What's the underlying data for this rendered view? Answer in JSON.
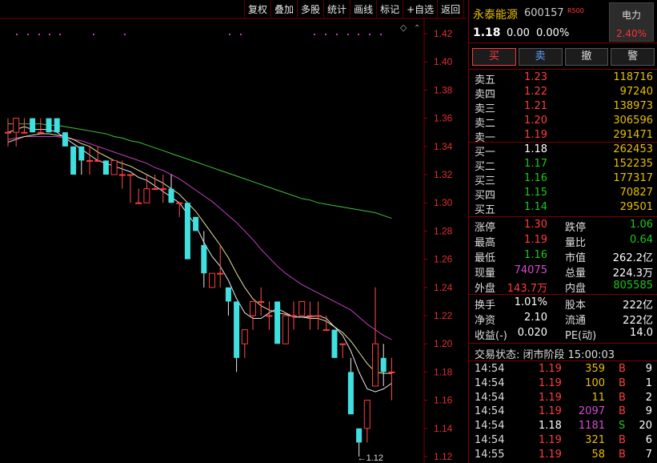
{
  "toolbar": [
    "复权",
    "叠加",
    "多股",
    "统计",
    "画线",
    "标记",
    "+自选",
    "返回"
  ],
  "chart_data": {
    "type": "candlestick",
    "yticks": [
      1.12,
      1.14,
      1.16,
      1.18,
      1.2,
      1.22,
      1.24,
      1.26,
      1.28,
      1.3,
      1.32,
      1.34,
      1.36,
      1.38,
      1.4,
      1.42
    ],
    "candles": [
      {
        "o": 1.35,
        "h": 1.36,
        "l": 1.34,
        "c": 1.35
      },
      {
        "o": 1.35,
        "h": 1.36,
        "l": 1.34,
        "c": 1.36
      },
      {
        "o": 1.35,
        "h": 1.36,
        "l": 1.35,
        "c": 1.35
      },
      {
        "o": 1.36,
        "h": 1.36,
        "l": 1.35,
        "c": 1.35
      },
      {
        "o": 1.35,
        "h": 1.36,
        "l": 1.35,
        "c": 1.35
      },
      {
        "o": 1.36,
        "h": 1.36,
        "l": 1.35,
        "c": 1.35
      },
      {
        "o": 1.36,
        "h": 1.36,
        "l": 1.35,
        "c": 1.35
      },
      {
        "o": 1.35,
        "h": 1.35,
        "l": 1.34,
        "c": 1.34
      },
      {
        "o": 1.34,
        "h": 1.34,
        "l": 1.32,
        "c": 1.32
      },
      {
        "o": 1.34,
        "h": 1.34,
        "l": 1.32,
        "c": 1.33
      },
      {
        "o": 1.33,
        "h": 1.34,
        "l": 1.32,
        "c": 1.33
      },
      {
        "o": 1.33,
        "h": 1.34,
        "l": 1.33,
        "c": 1.33
      },
      {
        "o": 1.33,
        "h": 1.33,
        "l": 1.32,
        "c": 1.32
      },
      {
        "o": 1.32,
        "h": 1.33,
        "l": 1.32,
        "c": 1.33
      },
      {
        "o": 1.32,
        "h": 1.33,
        "l": 1.31,
        "c": 1.32
      },
      {
        "o": 1.32,
        "h": 1.32,
        "l": 1.3,
        "c": 1.32
      },
      {
        "o": 1.3,
        "h": 1.31,
        "l": 1.3,
        "c": 1.3
      },
      {
        "o": 1.3,
        "h": 1.32,
        "l": 1.3,
        "c": 1.31
      },
      {
        "o": 1.31,
        "h": 1.32,
        "l": 1.31,
        "c": 1.31
      },
      {
        "o": 1.31,
        "h": 1.32,
        "l": 1.3,
        "c": 1.31
      },
      {
        "o": 1.31,
        "h": 1.32,
        "l": 1.3,
        "c": 1.3
      },
      {
        "o": 1.3,
        "h": 1.3,
        "l": 1.29,
        "c": 1.3
      },
      {
        "o": 1.3,
        "h": 1.3,
        "l": 1.26,
        "c": 1.26
      },
      {
        "o": 1.29,
        "h": 1.29,
        "l": 1.28,
        "c": 1.28
      },
      {
        "o": 1.27,
        "h": 1.28,
        "l": 1.24,
        "c": 1.25
      },
      {
        "o": 1.24,
        "h": 1.25,
        "l": 1.24,
        "c": 1.25
      },
      {
        "o": 1.25,
        "h": 1.27,
        "l": 1.24,
        "c": 1.25
      },
      {
        "o": 1.24,
        "h": 1.24,
        "l": 1.22,
        "c": 1.23
      },
      {
        "o": 1.23,
        "h": 1.23,
        "l": 1.18,
        "c": 1.19
      },
      {
        "o": 1.2,
        "h": 1.21,
        "l": 1.19,
        "c": 1.21
      },
      {
        "o": 1.22,
        "h": 1.23,
        "l": 1.21,
        "c": 1.23
      },
      {
        "o": 1.23,
        "h": 1.24,
        "l": 1.22,
        "c": 1.23
      },
      {
        "o": 1.22,
        "h": 1.23,
        "l": 1.21,
        "c": 1.22
      },
      {
        "o": 1.23,
        "h": 1.23,
        "l": 1.2,
        "c": 1.2
      },
      {
        "o": 1.2,
        "h": 1.22,
        "l": 1.2,
        "c": 1.22
      },
      {
        "o": 1.22,
        "h": 1.23,
        "l": 1.21,
        "c": 1.22
      },
      {
        "o": 1.22,
        "h": 1.23,
        "l": 1.22,
        "c": 1.23
      },
      {
        "o": 1.22,
        "h": 1.23,
        "l": 1.21,
        "c": 1.22
      },
      {
        "o": 1.22,
        "h": 1.23,
        "l": 1.21,
        "c": 1.22
      },
      {
        "o": 1.21,
        "h": 1.22,
        "l": 1.21,
        "c": 1.21
      },
      {
        "o": 1.21,
        "h": 1.21,
        "l": 1.19,
        "c": 1.19
      },
      {
        "o": 1.2,
        "h": 1.2,
        "l": 1.19,
        "c": 1.2
      },
      {
        "o": 1.18,
        "h": 1.19,
        "l": 1.15,
        "c": 1.15
      },
      {
        "o": 1.14,
        "h": 1.14,
        "l": 1.12,
        "c": 1.13
      },
      {
        "o": 1.14,
        "h": 1.16,
        "l": 1.13,
        "c": 1.16
      },
      {
        "o": 1.17,
        "h": 1.24,
        "l": 1.17,
        "c": 1.2
      },
      {
        "o": 1.19,
        "h": 1.2,
        "l": 1.17,
        "c": 1.18
      },
      {
        "o": 1.18,
        "h": 1.19,
        "l": 1.16,
        "c": 1.18
      }
    ],
    "ma_white": [
      1.35,
      1.352,
      1.354,
      1.352,
      1.352,
      1.352,
      1.35,
      1.346,
      1.342,
      1.338,
      1.334,
      1.33,
      1.328,
      1.326,
      1.324,
      1.322,
      1.318,
      1.316,
      1.312,
      1.308,
      1.304,
      1.3,
      1.292,
      1.284,
      1.272,
      1.262,
      1.255,
      1.245,
      1.232,
      1.222,
      1.218,
      1.218,
      1.222,
      1.225,
      1.222,
      1.219,
      1.219,
      1.219,
      1.22,
      1.218,
      1.212,
      1.206,
      1.195,
      1.18,
      1.168,
      1.166,
      1.168,
      1.172
    ],
    "ma_yellow": [
      1.343,
      1.345,
      1.347,
      1.348,
      1.349,
      1.349,
      1.348,
      1.347,
      1.345,
      1.342,
      1.34,
      1.336,
      1.333,
      1.33,
      1.328,
      1.326,
      1.323,
      1.32,
      1.317,
      1.314,
      1.31,
      1.306,
      1.3,
      1.294,
      1.286,
      1.278,
      1.27,
      1.261,
      1.25,
      1.24,
      1.232,
      1.227,
      1.224,
      1.222,
      1.221,
      1.219,
      1.219,
      1.218,
      1.218,
      1.216,
      1.212,
      1.208,
      1.202,
      1.194,
      1.186,
      1.18,
      1.179,
      1.179
    ],
    "ma_magenta": [
      1.345,
      1.346,
      1.347,
      1.347,
      1.347,
      1.347,
      1.347,
      1.346,
      1.345,
      1.344,
      1.342,
      1.34,
      1.338,
      1.336,
      1.334,
      1.332,
      1.33,
      1.328,
      1.325,
      1.323,
      1.32,
      1.317,
      1.313,
      1.309,
      1.305,
      1.301,
      1.296,
      1.291,
      1.286,
      1.28,
      1.274,
      1.267,
      1.261,
      1.255,
      1.25,
      1.246,
      1.242,
      1.239,
      1.236,
      1.233,
      1.23,
      1.227,
      1.224,
      1.219,
      1.214,
      1.21,
      1.206,
      1.203
    ],
    "ma_green": [
      1.356,
      1.356,
      1.356,
      1.356,
      1.356,
      1.355,
      1.355,
      1.354,
      1.353,
      1.352,
      1.351,
      1.35,
      1.349,
      1.347,
      1.346,
      1.344,
      1.343,
      1.341,
      1.339,
      1.337,
      1.335,
      1.333,
      1.331,
      1.329,
      1.327,
      1.325,
      1.323,
      1.321,
      1.319,
      1.317,
      1.315,
      1.313,
      1.311,
      1.309,
      1.307,
      1.305,
      1.303,
      1.302,
      1.3,
      1.299,
      1.298,
      1.297,
      1.296,
      1.295,
      1.294,
      1.293,
      1.291,
      1.289
    ],
    "low_label": "1.12"
  },
  "stock": {
    "name": "永泰能源",
    "code": "600157",
    "r_tag": "R500",
    "price": "1.18",
    "change": "0.00",
    "change_pct": "0.00%"
  },
  "sector": {
    "name": "电力",
    "change": "2.40%"
  },
  "buttons": {
    "buy": "买",
    "sell": "卖",
    "cancel": "撤",
    "warn": "警"
  },
  "asks": [
    {
      "label": "卖五",
      "price": "1.23",
      "vol": "118716"
    },
    {
      "label": "卖四",
      "price": "1.22",
      "vol": "97240"
    },
    {
      "label": "卖三",
      "price": "1.21",
      "vol": "138973"
    },
    {
      "label": "卖二",
      "price": "1.20",
      "vol": "306596"
    },
    {
      "label": "卖一",
      "price": "1.19",
      "vol": "291471"
    }
  ],
  "bids": [
    {
      "label": "买一",
      "price": "1.18",
      "vol": "262453"
    },
    {
      "label": "买二",
      "price": "1.17",
      "vol": "152235"
    },
    {
      "label": "买三",
      "price": "1.16",
      "vol": "177317"
    },
    {
      "label": "买四",
      "price": "1.15",
      "vol": "70827"
    },
    {
      "label": "买五",
      "price": "1.14",
      "vol": "29501"
    }
  ],
  "stats": [
    {
      "l1": "涨停",
      "v1": "1.30",
      "c1": "red",
      "l2": "跌停",
      "v2": "1.06",
      "c2": "green"
    },
    {
      "l1": "最高",
      "v1": "1.19",
      "c1": "red",
      "l2": "量比",
      "v2": "0.64",
      "c2": "green"
    },
    {
      "l1": "最低",
      "v1": "1.16",
      "c1": "green",
      "l2": "市值",
      "v2": "262.2亿",
      "c2": "white"
    },
    {
      "l1": "现量",
      "v1": "74075",
      "c1": "purple",
      "l2": "总量",
      "v2": "224.3万",
      "c2": "white"
    },
    {
      "l1": "外盘",
      "v1": "143.7万",
      "c1": "red",
      "l2": "内盘",
      "v2": "805585",
      "c2": "green"
    }
  ],
  "stats2": [
    {
      "l1": "换手",
      "v1": "1.01%",
      "l2": "股本",
      "v2": "222亿"
    },
    {
      "l1": "净资",
      "v1": "2.10",
      "l2": "流通",
      "v2": "222亿"
    },
    {
      "l1": "收益(-)",
      "v1": "0.020",
      "l2": "PE(动)",
      "v2": "14.0"
    }
  ],
  "trade_status": "交易状态: 闭市阶段 15:00:03",
  "ticks": [
    {
      "t": "14:54",
      "p": "1.19",
      "pc": "red",
      "v": "359",
      "vc": "yellow",
      "bs": "B",
      "bc": "red",
      "n": "9"
    },
    {
      "t": "14:54",
      "p": "1.19",
      "pc": "red",
      "v": "100",
      "vc": "yellow",
      "bs": "B",
      "bc": "red",
      "n": "1"
    },
    {
      "t": "14:54",
      "p": "1.19",
      "pc": "red",
      "v": "11",
      "vc": "yellow",
      "bs": "B",
      "bc": "red",
      "n": "2"
    },
    {
      "t": "14:54",
      "p": "1.19",
      "pc": "red",
      "v": "2097",
      "vc": "purple",
      "bs": "B",
      "bc": "red",
      "n": "9"
    },
    {
      "t": "14:54",
      "p": "1.18",
      "pc": "white",
      "v": "1181",
      "vc": "purple",
      "bs": "S",
      "bc": "green",
      "n": "20"
    },
    {
      "t": "14:54",
      "p": "1.19",
      "pc": "red",
      "v": "321",
      "vc": "yellow",
      "bs": "B",
      "bc": "red",
      "n": "6"
    },
    {
      "t": "14:55",
      "p": "1.19",
      "pc": "red",
      "v": "58",
      "vc": "yellow",
      "bs": "B",
      "bc": "red",
      "n": "7"
    }
  ]
}
